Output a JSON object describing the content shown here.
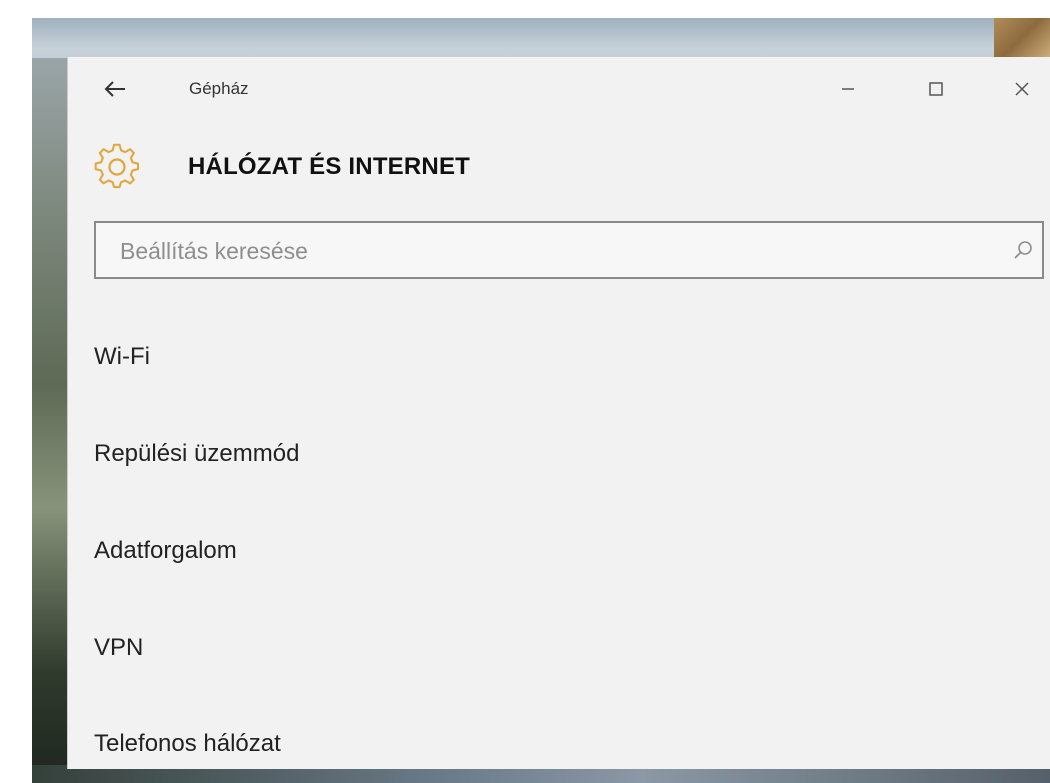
{
  "window": {
    "app_name": "Gépház",
    "controls": {
      "minimize": "–",
      "maximize": "□",
      "close": "✕"
    },
    "back_icon": "back-arrow-icon"
  },
  "header": {
    "title": "HÁLÓZAT ÉS INTERNET",
    "icon": "gear-icon",
    "icon_color": "#e3a53a"
  },
  "search": {
    "placeholder": "Beállítás keresése",
    "value": "",
    "icon": "search-icon"
  },
  "nav": {
    "items": [
      {
        "label": "Wi-Fi"
      },
      {
        "label": "Repülési üzemmód"
      },
      {
        "label": "Adatforgalom"
      },
      {
        "label": "VPN"
      },
      {
        "label": "Telefonos hálózat"
      }
    ]
  }
}
